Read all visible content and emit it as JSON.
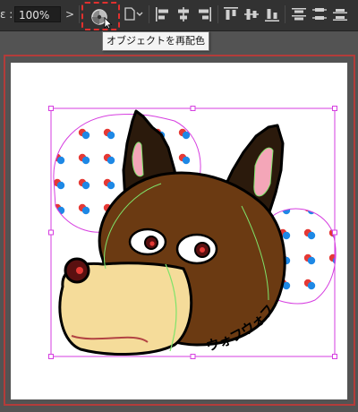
{
  "toolbar": {
    "zoom_label": "ε :",
    "zoom_value": "100%",
    "zoom_arrow": ">",
    "recolor_icon": "color-wheel-icon",
    "document_icon": "document-dropdown-icon",
    "align_icons": [
      "align-left-icon",
      "align-horizontal-center-icon",
      "align-right-icon",
      "align-top-icon",
      "align-vertical-center-icon",
      "align-bottom-icon",
      "distribute-top-icon",
      "distribute-vertical-center-icon",
      "distribute-bottom-icon"
    ]
  },
  "tooltip": {
    "text": "オブジェクトを再配色"
  },
  "artwork": {
    "caption_text": "ウォフウォフ"
  },
  "colors": {
    "toolbar_bg": "#323232",
    "canvas_bg": "#535353",
    "highlight": "#e0302e",
    "selection": "#d63ee0",
    "fur": "#6b3a12",
    "muzzle": "#f5dc9a",
    "dot_red": "#e53935",
    "dot_blue": "#1e88e5"
  }
}
